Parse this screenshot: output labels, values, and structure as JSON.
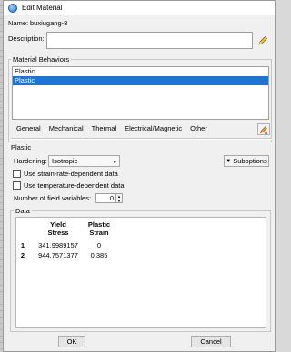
{
  "window": {
    "title": "Edit Material"
  },
  "name_field": {
    "label": "Name:",
    "value": "buxiugang-8"
  },
  "description": {
    "label": "Description:",
    "value": ""
  },
  "behaviors": {
    "title": "Material Behaviors",
    "items": [
      {
        "label": "Elastic",
        "selected": false
      },
      {
        "label": "Plastic",
        "selected": true
      }
    ]
  },
  "menus": [
    "General",
    "Mechanical",
    "Thermal",
    "Electrical/Magnetic",
    "Other"
  ],
  "plastic_section": {
    "title": "Plastic",
    "hardening_label": "Hardening:",
    "hardening_value": "Isotropic",
    "suboptions_label": "Suboptions",
    "strain_rate_label": "Use strain-rate-dependent data",
    "temperature_label": "Use temperature-dependent data",
    "field_vars_label": "Number of field variables:",
    "field_vars_value": "0"
  },
  "data_table": {
    "title": "Data",
    "headers": [
      {
        "line1": "Yield",
        "line2": "Stress"
      },
      {
        "line1": "Plastic",
        "line2": "Strain"
      }
    ],
    "rows": [
      {
        "index": "1",
        "yield_stress": "341.9989157",
        "plastic_strain": "0"
      },
      {
        "index": "2",
        "yield_stress": "944.7571377",
        "plastic_strain": "0.385"
      }
    ]
  },
  "buttons": {
    "ok": "OK",
    "cancel": "Cancel"
  },
  "colors": {
    "selection": "#1e74d3",
    "window_bg": "#f0f0f0"
  }
}
